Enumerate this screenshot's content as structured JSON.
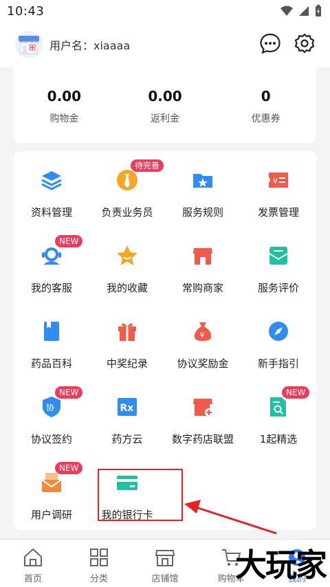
{
  "status": {
    "time": "10:43"
  },
  "header": {
    "username_label": "用户名：xiaaaa",
    "icons": [
      "chat-icon",
      "settings-gear-icon"
    ]
  },
  "stats": [
    {
      "value": "0.00",
      "label": "购物金"
    },
    {
      "value": "0.00",
      "label": "返利金"
    },
    {
      "value": "0",
      "label": "优惠券"
    }
  ],
  "menu": [
    {
      "label": "资料管理",
      "icon": "layers-icon",
      "color": "#2f8cf0"
    },
    {
      "label": "负责业务员",
      "icon": "tie-icon",
      "color": "#f5a623",
      "badge": "待完善"
    },
    {
      "label": "服务规则",
      "icon": "star-folder-icon",
      "color": "#2f8cf0"
    },
    {
      "label": "发票管理",
      "icon": "invoice-icon",
      "color": "#f05a4a"
    },
    {
      "label": "我的客服",
      "icon": "customer-service-icon",
      "color": "#2f8cf0",
      "badge": "NEW"
    },
    {
      "label": "我的收藏",
      "icon": "star-icon",
      "color": "#f5a623"
    },
    {
      "label": "常购商家",
      "icon": "shop-icon",
      "color": "#f05a4a"
    },
    {
      "label": "服务评价",
      "icon": "review-icon",
      "color": "#21c0a0"
    },
    {
      "label": "药品百科",
      "icon": "book-icon",
      "color": "#2f8cf0"
    },
    {
      "label": "中奖纪录",
      "icon": "gift-icon",
      "color": "#f05a4a"
    },
    {
      "label": "协议奖励金",
      "icon": "money-bag-icon",
      "color": "#f05a4a"
    },
    {
      "label": "新手指引",
      "icon": "compass-icon",
      "color": "#2f8cf0"
    },
    {
      "label": "协议签约",
      "icon": "shield-icon",
      "color": "#2f8cf0",
      "badge": "NEW"
    },
    {
      "label": "药方云",
      "icon": "rx-icon",
      "color": "#2f8cf0"
    },
    {
      "label": "数字药店联盟",
      "icon": "store-plus-icon",
      "color": "#f05a4a"
    },
    {
      "label": "1起精选",
      "icon": "doc-search-icon",
      "color": "#21c0a0",
      "badge": "NEW"
    },
    {
      "label": "用户调研",
      "icon": "mail-icon",
      "color": "#f08a3a",
      "badge": "NEW"
    },
    {
      "label": "我的银行卡",
      "icon": "bank-card-icon",
      "color": "#21c0a0"
    }
  ],
  "tabbar": [
    {
      "label": "首页",
      "icon": "home-icon"
    },
    {
      "label": "分类",
      "icon": "category-grid-icon"
    },
    {
      "label": "店铺馆",
      "icon": "store-icon"
    },
    {
      "label": "购物车",
      "icon": "cart-icon"
    },
    {
      "label": "我的",
      "icon": "profile-icon",
      "active": true
    }
  ],
  "watermark": "大玩家",
  "colors": {
    "accent": "#2f7cf6",
    "badge": "#f03a5a",
    "annotation": "#e52222"
  }
}
